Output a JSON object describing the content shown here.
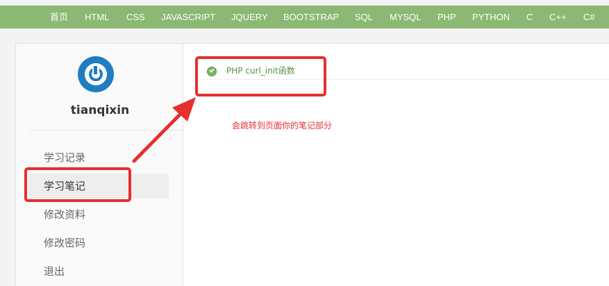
{
  "nav": {
    "items": [
      "首页",
      "HTML",
      "CSS",
      "JAVASCRIPT",
      "JQUERY",
      "BOOTSTRAP",
      "SQL",
      "MYSQL",
      "PHP",
      "PYTHON",
      "C",
      "C++",
      "C#"
    ]
  },
  "user": {
    "name": "tianqixin"
  },
  "sidebar": {
    "items": [
      {
        "label": "学习记录"
      },
      {
        "label": "学习笔记"
      },
      {
        "label": "修改资料"
      },
      {
        "label": "修改密码"
      },
      {
        "label": "退出"
      }
    ],
    "active_index": 1
  },
  "main": {
    "notes": [
      {
        "title": "PHP curl_init函数"
      }
    ]
  },
  "annotation": {
    "text": "会跳转到页面你的笔记部分"
  },
  "colors": {
    "nav_bg": "#8bb872",
    "accent_green": "#5a8f3e",
    "annotation_red": "#e62f2f",
    "avatar_blue": "#1f7ec2"
  }
}
